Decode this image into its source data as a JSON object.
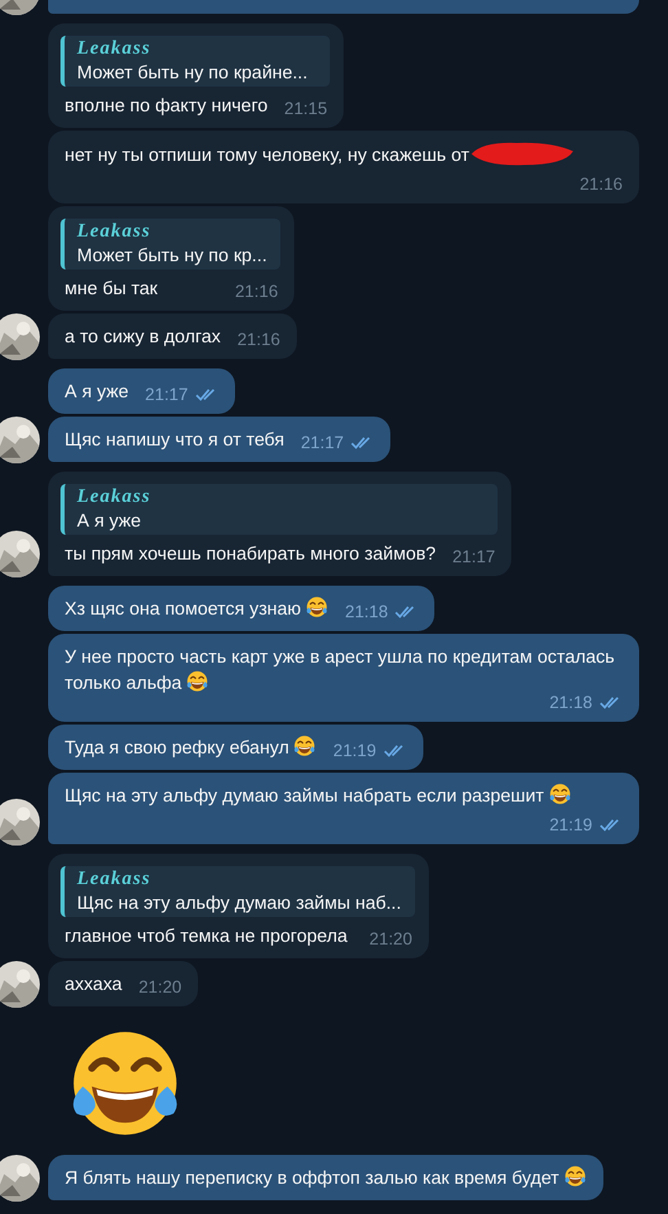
{
  "messages": [
    {
      "kind": "outgoing",
      "cut": true,
      "avatar": true
    },
    {
      "kind": "incoming",
      "reply": {
        "name": "Leakass",
        "text": "Может быть ну по крайне..."
      },
      "text": "вполне по факту ничего",
      "time": "21:15",
      "avatar": false
    },
    {
      "kind": "incoming",
      "text": "нет ну ты отпиши тому человеку, ну скажешь от",
      "redacted": true,
      "time": "21:16",
      "avatar": false
    },
    {
      "kind": "incoming",
      "reply": {
        "name": "Leakass",
        "text": "Может быть ну по кр..."
      },
      "text": "мне бы так",
      "time": "21:16",
      "avatar": false
    },
    {
      "kind": "incoming",
      "text": "а то сижу в долгах",
      "time": "21:16",
      "avatar": true
    },
    {
      "kind": "outgoing",
      "text": "А я уже",
      "time": "21:17",
      "avatar": false
    },
    {
      "kind": "outgoing",
      "text": "Щяс напишу что я от тебя",
      "time": "21:17",
      "avatar": true
    },
    {
      "kind": "incoming",
      "reply": {
        "name": "Leakass",
        "text": "А я уже"
      },
      "text": "ты прям хочешь понабирать много займов?",
      "time": "21:17",
      "avatar": true
    },
    {
      "kind": "outgoing",
      "text": "Хз щяс она помоется узнаю",
      "emoji": true,
      "time": "21:18",
      "avatar": false
    },
    {
      "kind": "outgoing",
      "text": "У нее просто часть карт уже в арест ушла по кредитам осталась только альфа",
      "emoji": true,
      "time": "21:18",
      "avatar": false
    },
    {
      "kind": "outgoing",
      "text": "Туда я свою рефку ебанул",
      "emoji": true,
      "time": "21:19",
      "avatar": false
    },
    {
      "kind": "outgoing",
      "text": "Щяс на эту альфу думаю займы набрать если разрешит",
      "emoji": true,
      "time": "21:19",
      "avatar": true
    },
    {
      "kind": "incoming",
      "reply": {
        "name": "Leakass",
        "text": "Щяс на эту альфу думаю займы наб..."
      },
      "text": "главное чтоб темка не прогорела",
      "time": "21:20",
      "avatar": false
    },
    {
      "kind": "incoming",
      "text": "аххаха",
      "time": "21:20",
      "avatar": true
    },
    {
      "kind": "sticker",
      "avatar": false
    },
    {
      "kind": "outgoing",
      "text": "Я блять нашу переписку в оффтоп залью как время будет",
      "emoji": true,
      "avatar": true
    }
  ]
}
